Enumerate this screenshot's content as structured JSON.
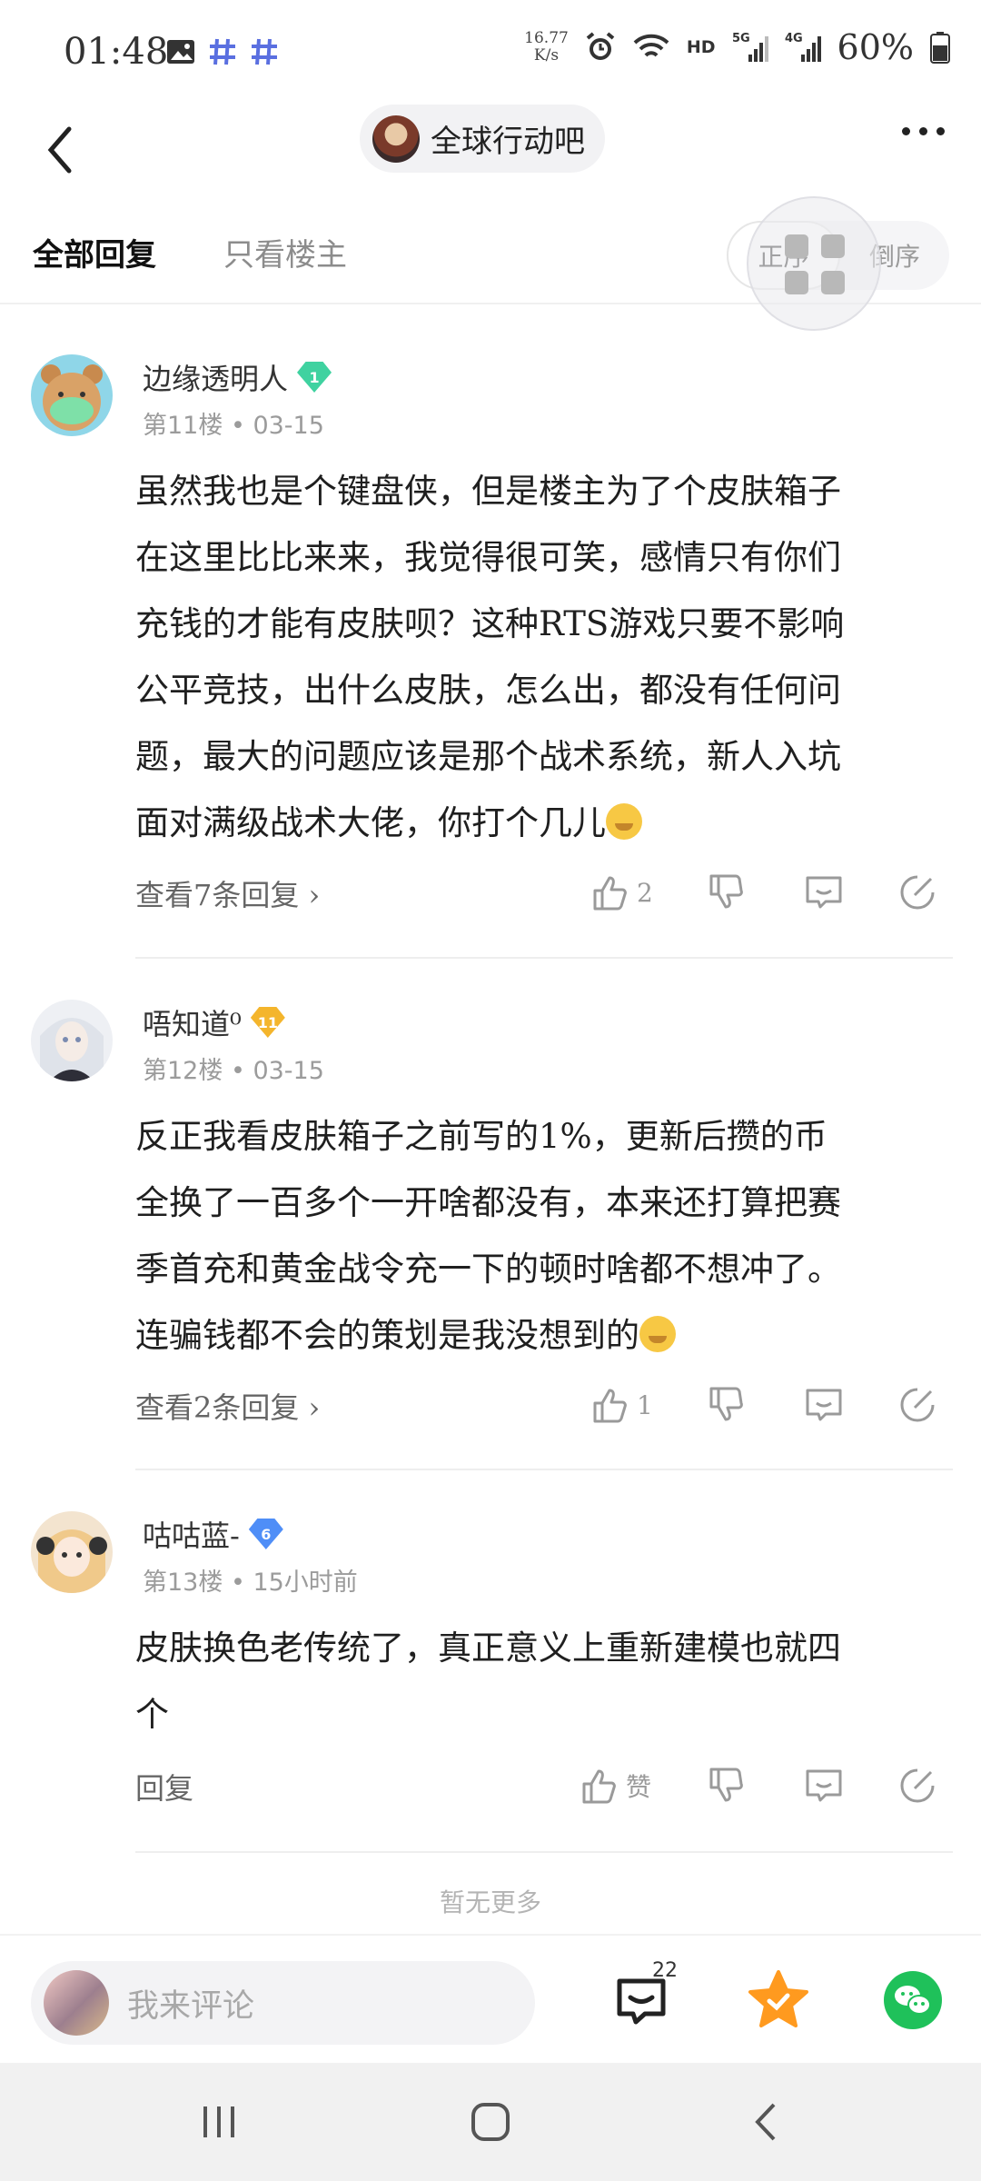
{
  "status_bar": {
    "time": "01:48",
    "net_speed_value": "16.77",
    "net_speed_unit": "K/s",
    "battery": "60%",
    "icons": [
      "image-icon",
      "hash-icon",
      "hash-icon",
      "alarm-icon",
      "wifi-icon",
      "hd-icon",
      "5g-signal-icon",
      "4g-signal-icon",
      "battery-icon"
    ]
  },
  "header": {
    "forum_name": "全球行动吧"
  },
  "tabs": {
    "all": "全部回复",
    "op_only": "只看楼主",
    "order_asc": "正序",
    "order_desc": "倒序"
  },
  "posts": [
    {
      "username": "边缘透明人",
      "level": "1",
      "floor": "第11楼",
      "date": "03-15",
      "lines": [
        "虽然我也是个键盘侠，但是楼主为了个皮肤箱子",
        "在这里比比来来，我觉得很可笑，感情只有你们",
        "充钱的才能有皮肤呗？这种RTS游戏只要不影响",
        "公平竞技，出什么皮肤，怎么出，都没有任何问",
        "题，最大的问题应该是那个战术系统，新人入坑",
        "面对满级战术大佬，你打个几儿"
      ],
      "reply_link": "查看7条回复",
      "likes": "2"
    },
    {
      "username": "唔知道⁰",
      "level": "11",
      "floor": "第12楼",
      "date": "03-15",
      "lines": [
        "反正我看皮肤箱子之前写的1%，更新后攒的币",
        "全换了一百多个一开啥都没有，本来还打算把赛",
        "季首充和黄金战令充一下的顿时啥都不想冲了。",
        "连骗钱都不会的策划是我没想到的"
      ],
      "reply_link": "查看2条回复",
      "likes": "1"
    },
    {
      "username": "咕咕蓝-",
      "level": "6",
      "floor": "第13楼",
      "date": "15小时前",
      "lines": [
        "皮肤换色老传统了，真正意义上重新建模也就四",
        "个"
      ],
      "reply_link": "回复",
      "likes": "赞"
    }
  ],
  "no_more": "暂无更多",
  "bottom_bar": {
    "comment_placeholder": "我来评论",
    "comment_count": "22"
  },
  "colors": {
    "badge_green": "#3fd2a0",
    "badge_gold": "#f4b52c",
    "badge_blue": "#4f8ef7",
    "star_orange": "#ff9a1f",
    "wechat_green": "#1fc15a"
  }
}
